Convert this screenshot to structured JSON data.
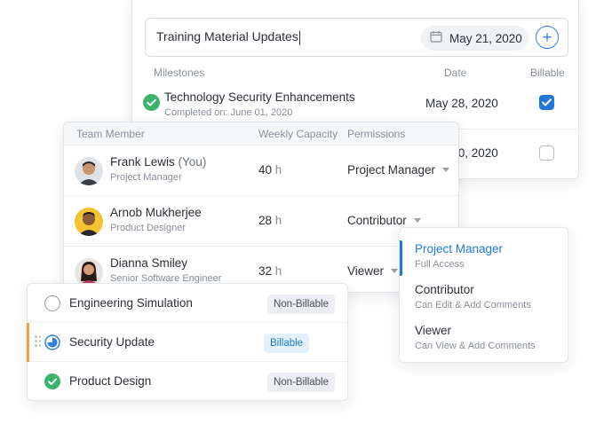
{
  "milestones_card": {
    "input_value": "Training Material Updates",
    "date": "May 21, 2020",
    "add_label": "+",
    "headers": {
      "milestones": "Milestones",
      "date": "Date",
      "billable": "Billable"
    },
    "rows": [
      {
        "title": "Technology Security Enhancements",
        "completed": "Completed on: June 01, 2020",
        "date": "May 28, 2020",
        "billable": true
      },
      {
        "title": "",
        "completed": "",
        "date": "May 20, 2020",
        "billable": false
      }
    ]
  },
  "team_card": {
    "headers": {
      "member": "Team Member",
      "capacity": "Weekly Capacity",
      "permissions": "Permissions"
    },
    "members": [
      {
        "name": "Frank Lewis",
        "you": "(You)",
        "role": "Project Manager",
        "capacity": "40",
        "unit": "h",
        "permission": "Project Manager"
      },
      {
        "name": "Arnob Mukherjee",
        "you": "",
        "role": "Product Designer",
        "capacity": "28",
        "unit": "h",
        "permission": "Contributor"
      },
      {
        "name": "Dianna Smiley",
        "you": "",
        "role": "Senior Software Engineer",
        "capacity": "32",
        "unit": "h",
        "permission": "Viewer"
      }
    ]
  },
  "permission_menu": {
    "items": [
      {
        "label": "Project Manager",
        "desc": "Full Access",
        "active": true
      },
      {
        "label": "Contributor",
        "desc": "Can Edit & Add Comments",
        "active": false
      },
      {
        "label": "Viewer",
        "desc": "Can View & Add Comments",
        "active": false
      }
    ]
  },
  "tasks_card": {
    "tasks": [
      {
        "name": "Engineering Simulation",
        "badge": "Non-Billable",
        "status": "open"
      },
      {
        "name": "Security Update",
        "badge": "Billable",
        "status": "in-progress"
      },
      {
        "name": "Product Design",
        "badge": "Non-Billable",
        "status": "done"
      }
    ]
  },
  "colors": {
    "accent": "#1f78d8",
    "success": "#3cb26b",
    "drag_accent": "#f2a03d"
  }
}
